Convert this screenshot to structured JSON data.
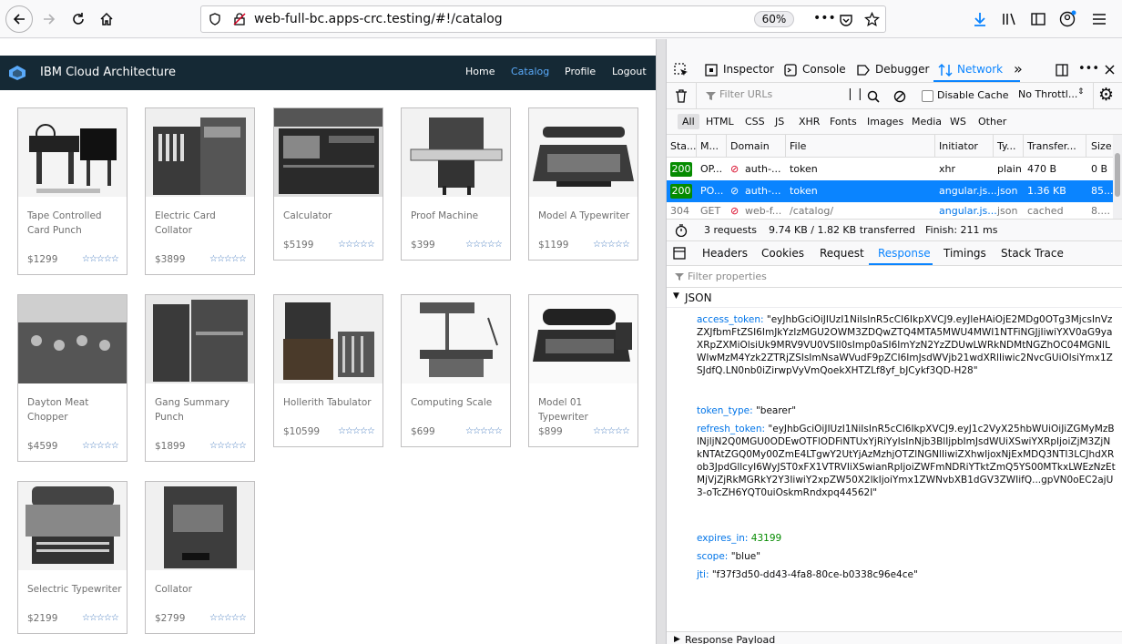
{
  "browser": {
    "url": "web-full-bc.apps-crc.testing/#!/catalog",
    "zoom": "60%"
  },
  "app": {
    "title": "IBM Cloud Architecture",
    "nav": [
      "Home",
      "Catalog",
      "Profile",
      "Logout"
    ],
    "active_nav": "Catalog",
    "star_glyph": "☆☆☆☆☆"
  },
  "catalog": [
    {
      "name": "Tape Controlled Card Punch",
      "price": "$1299"
    },
    {
      "name": "Electric Card Collator",
      "price": "$3899"
    },
    {
      "name": "Calculator",
      "price": "$5199"
    },
    {
      "name": "Proof Machine",
      "price": "$399"
    },
    {
      "name": "Model A Typewriter",
      "price": "$1199"
    },
    {
      "name": "Dayton Meat Chopper",
      "price": "$4599"
    },
    {
      "name": "Gang Summary Punch",
      "price": "$1899"
    },
    {
      "name": "Hollerith Tabulator",
      "price": "$10599"
    },
    {
      "name": "Computing Scale",
      "price": "$699"
    },
    {
      "name": "Model 01 Typewriter",
      "price": "$899"
    },
    {
      "name": "Selectric Typewriter",
      "price": "$2199"
    },
    {
      "name": "Collator",
      "price": "$2799"
    }
  ],
  "devtools": {
    "tabs": [
      "Inspector",
      "Console",
      "Debugger",
      "Network"
    ],
    "active_tab": "Network",
    "filter_placeholder": "Filter URLs",
    "disable_cache": "Disable Cache",
    "throttling": "No Throttl...",
    "type_filters": [
      "All",
      "HTML",
      "CSS",
      "JS",
      "XHR",
      "Fonts",
      "Images",
      "Media",
      "WS",
      "Other"
    ],
    "columns": [
      "Sta...",
      "M...",
      "Domain",
      "File",
      "Initiator",
      "Ty...",
      "Transfer...",
      "Size"
    ],
    "requests": [
      {
        "status": "200",
        "method": "OP...",
        "domain": "auth-...",
        "file": "token",
        "initiator": "xhr",
        "type": "plain",
        "transferred": "470 B",
        "size": "0 B"
      },
      {
        "status": "200",
        "method": "PO...",
        "domain": "auth-...",
        "file": "token",
        "initiator": "angular.js...",
        "type": "json",
        "transferred": "1.36 KB",
        "size": "85..."
      },
      {
        "status": "304",
        "method": "GET",
        "domain": "web-f...",
        "file": "/catalog/",
        "initiator": "angular.js...",
        "type": "json",
        "transferred": "cached",
        "size": "8...."
      }
    ],
    "summary": {
      "requests": "3 requests",
      "transferred": "9.74 KB / 1.82 KB transferred",
      "finish": "Finish: 211 ms"
    },
    "detail_tabs": [
      "Headers",
      "Cookies",
      "Request",
      "Response",
      "Timings",
      "Stack Trace"
    ],
    "active_detail_tab": "Response",
    "filter_props": "Filter properties",
    "json_label": "JSON",
    "json": {
      "access_token_key": "access_token:",
      "access_token": "\"eyJhbGciOiJIUzI1NiIsInR5cCI6IkpXVCJ9.eyJleHAiOjE2MDg0OTg3MjcsInVzZXJfbmFtZSI6ImJkYzIzMGU2OWM3ZDQwZTQ4MTA5MWU4MWI1NTFiNGJjIiwiYXV0aG9yaXRpZXMiOlsiUk9MRV9VU0VSIl0sImp0aSI6ImYzN2YzZDUwLWRkNDMtNGZhOC04MGNlLWIwMzM4Yzk2ZTRjZSIsImNsaWVudF9pZCI6ImJsdWVjb21wdXRlIiwic2NvcGUiOlsiYmx1ZSJdfQ.LN0nb0iZirwpVyVmQoekXHTZLf8yf_bJCykf3QD-H28\"",
      "token_type_key": "token_type:",
      "token_type": "\"bearer\"",
      "refresh_token_key": "refresh_token:",
      "refresh_token": "\"eyJhbGciOiJIUzI1NiIsInR5cCI6IkpXVCJ9.eyJ1c2VyX25hbWUiOiJiZGMyMzBlNjljN2Q0MGU0ODEwOTFlODFiNTUxYjRiYyIsInNjb3BlIjpbImJsdWUiXSwiYXRpIjoiZjM3ZjNkNTAtZGQ0My00ZmE4LTgwY2UtYjAzMzhjOTZlNGNlIiwiZXhwIjoxNjExMDQ3NTI3LCJhdXRob3JpdGllcyI6WyJST0xFX1VTRVIiXSwianRpIjoiZWFmNDRiYTktZmQ5YS00MTkxLWEzNzEtMjVjZjRkMGRkY2Y3IiwiY2xpZW50X2lkIjoiYmx1ZWNvbXB1dGV3ZWIifQ...gpVN0oEC2ajU3-oTcZH6YQT0uiOskmRndxpq44562I\"",
      "expires_in_key": "expires_in:",
      "expires_in": "43199",
      "scope_key": "scope:",
      "scope": "\"blue\"",
      "jti_key": "jti:",
      "jti": "\"f37f3d50-dd43-4fa8-80ce-b0338c96e4ce\""
    },
    "payload_label": "Response Payload"
  }
}
